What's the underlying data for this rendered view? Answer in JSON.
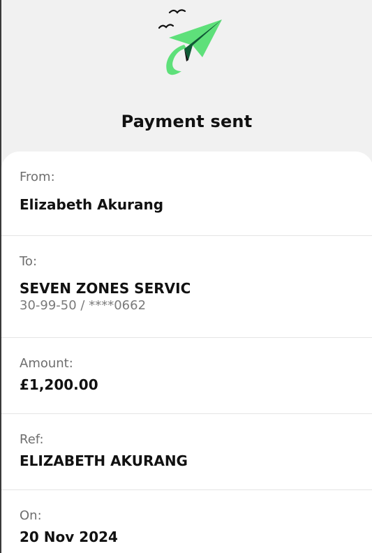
{
  "header": {
    "title": "Payment sent",
    "illustration_icon": "paper-plane-with-birds-icon"
  },
  "details": {
    "from": {
      "label": "From:",
      "value": "Elizabeth Akurang"
    },
    "to": {
      "label": "To:",
      "value": "SEVEN ZONES SERVIC",
      "account": "30-99-50 / ****0662"
    },
    "amount": {
      "label": "Amount:",
      "value": "£1,200.00"
    },
    "ref": {
      "label": "Ref:",
      "value": "ELIZABETH AKURANG"
    },
    "on": {
      "label": "On:",
      "value": "20 Nov 2024"
    }
  },
  "colors": {
    "accent_green": "#5ee07a",
    "dark_green": "#0f5a35",
    "background": "#f1f1f1",
    "card": "#ffffff"
  }
}
